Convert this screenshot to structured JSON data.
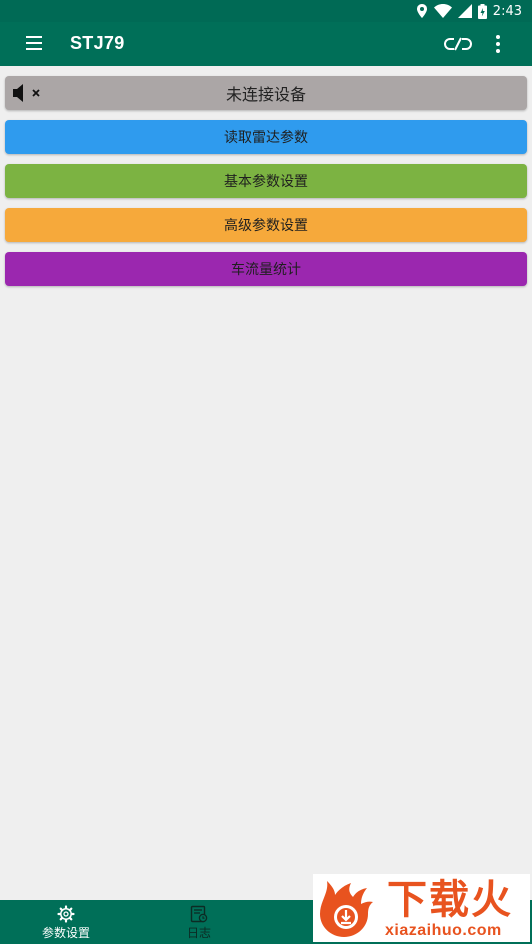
{
  "status_bar": {
    "time": "2:43"
  },
  "app_bar": {
    "title": "STJ79"
  },
  "device_status": {
    "label": "未连接设备"
  },
  "actions": [
    {
      "label": "读取雷达参数",
      "color": "#2f9bee"
    },
    {
      "label": "基本参数设置",
      "color": "#7cb342"
    },
    {
      "label": "高级参数设置",
      "color": "#f6a93b"
    },
    {
      "label": "车流量统计",
      "color": "#9b27af"
    }
  ],
  "bottom_nav": [
    {
      "label": "参数设置",
      "icon": "gear-icon"
    },
    {
      "label": "日志",
      "icon": "log-icon"
    }
  ],
  "watermark": {
    "logo_text": "下载火",
    "url": "xiazaihuo.com"
  },
  "colors": {
    "primary": "#006f58",
    "background": "#efefef"
  }
}
